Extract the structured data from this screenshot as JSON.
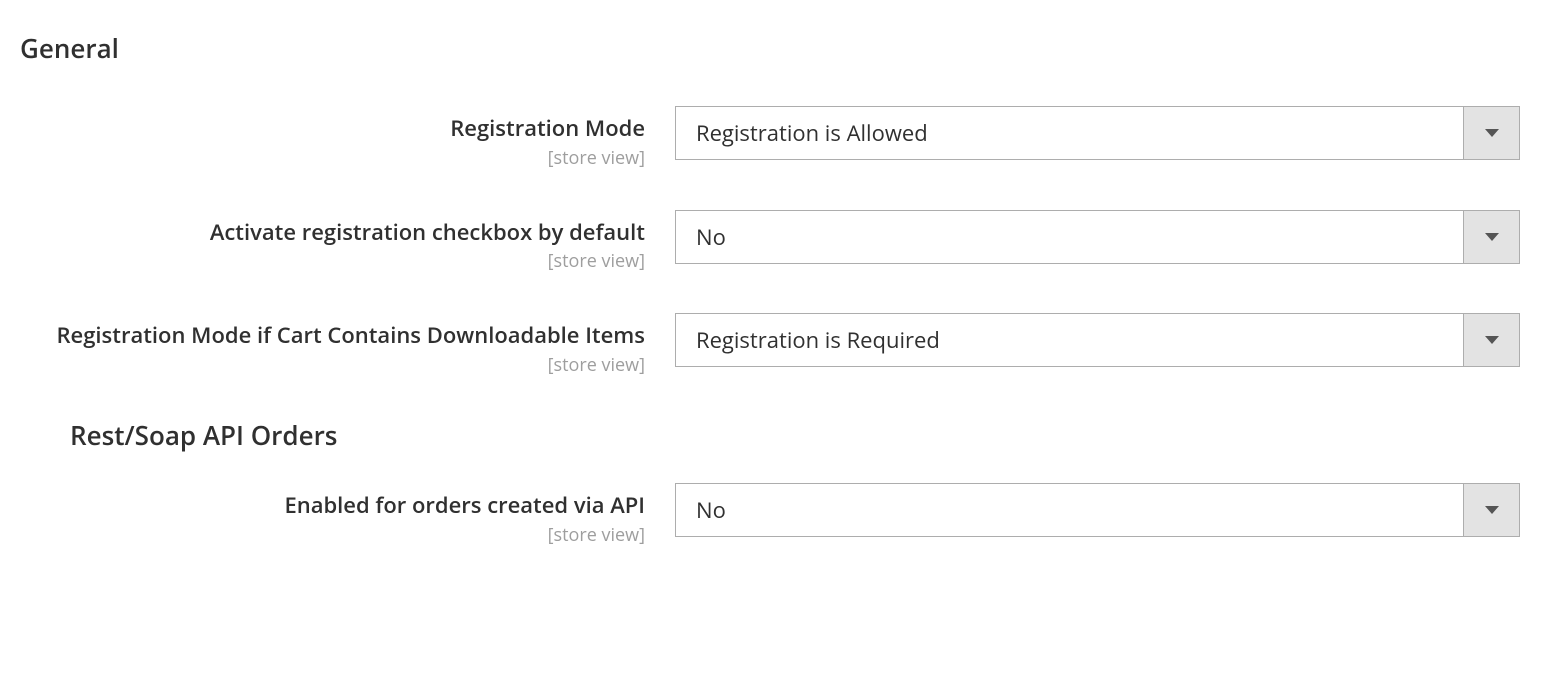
{
  "sections": {
    "general": {
      "title": "General",
      "fields": {
        "registration_mode": {
          "label": "Registration Mode",
          "scope": "[store view]",
          "value": "Registration is Allowed"
        },
        "activate_checkbox": {
          "label": "Activate registration checkbox by default",
          "scope": "[store view]",
          "value": "No"
        },
        "registration_mode_downloadable": {
          "label": "Registration Mode if Cart Contains Downloadable Items",
          "scope": "[store view]",
          "value": "Registration is Required"
        }
      }
    },
    "api_orders": {
      "title": "Rest/Soap API Orders",
      "fields": {
        "enabled_api": {
          "label": "Enabled for orders created via API",
          "scope": "[store view]",
          "value": "No"
        }
      }
    }
  }
}
